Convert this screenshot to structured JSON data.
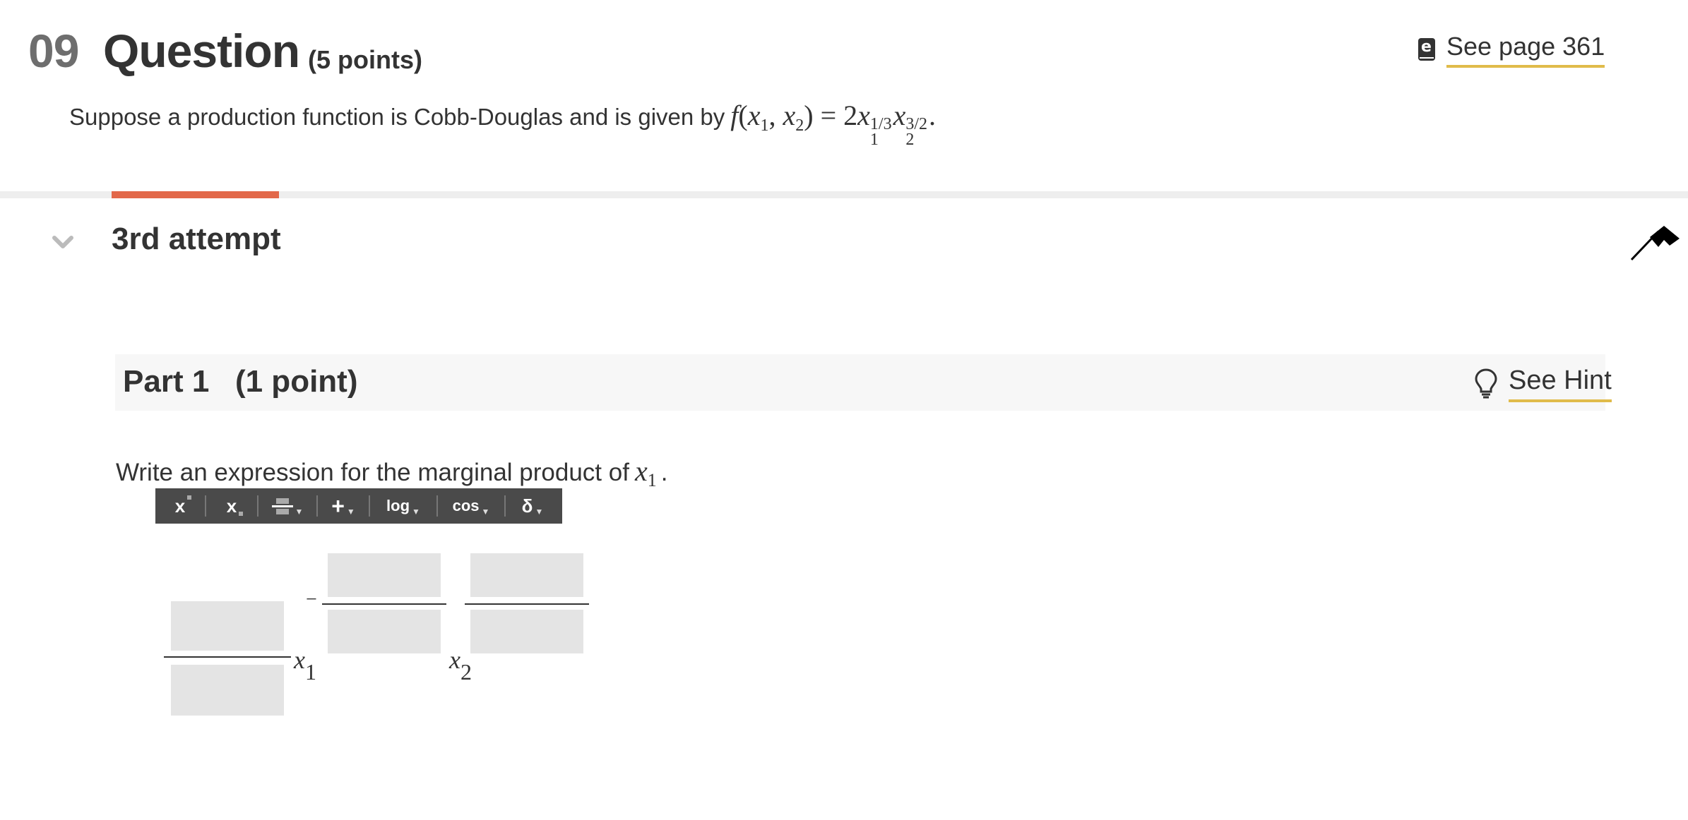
{
  "header": {
    "question_number": "09",
    "question_label": "Question",
    "points": "(5 points)",
    "see_page": "See page 361"
  },
  "prompt": {
    "text": "Suppose a production function is Cobb-Douglas and is given by",
    "f": "f",
    "open_paren": "(",
    "x": "x",
    "sub1": "1",
    "comma": ", ",
    "sub2": "2",
    "close_paren": ")",
    "equals": " = 2",
    "exp1": "1/3",
    "exp2": "3/2",
    "period": "."
  },
  "attempt": {
    "label": "3rd attempt"
  },
  "part": {
    "title": "Part 1   (1 point)",
    "hint": "See Hint"
  },
  "question": {
    "instruction": "Write an expression for the marginal product of",
    "var": "x",
    "var_sub": "1",
    "period": "."
  },
  "toolbar": {
    "buttons": [
      {
        "label": "x",
        "icon": "superscript-icon"
      },
      {
        "label": "x",
        "icon": "subscript-icon"
      },
      {
        "label": "",
        "icon": "fraction-icon"
      },
      {
        "label": "+",
        "icon": "operators-icon"
      },
      {
        "label": "log",
        "icon": "log-icon"
      },
      {
        "label": "cos",
        "icon": "trig-icon"
      },
      {
        "label": "δ",
        "icon": "greek-icon"
      }
    ]
  },
  "answer": {
    "var1": "x",
    "var1_sub": "1",
    "var2": "x",
    "var2_sub": "2",
    "minus": "−"
  },
  "colors": {
    "accent": "#e2684a",
    "link_underline": "#e0bb4a",
    "toolbar_bg": "#4a4a4a",
    "input_box": "#e4e4e4"
  }
}
